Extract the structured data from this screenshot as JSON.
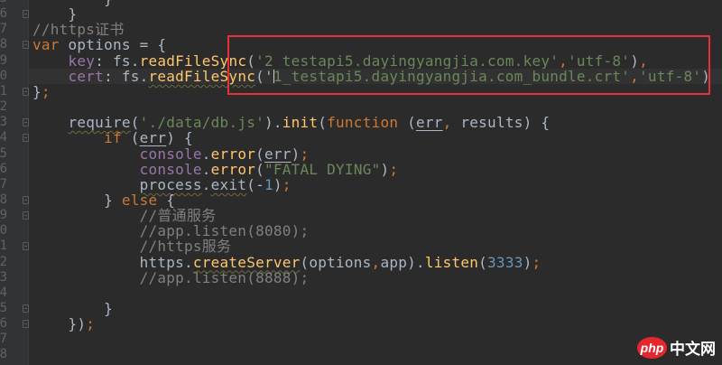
{
  "editor": {
    "current_line_index": 5,
    "lines": [
      {
        "num": "5",
        "fold": false,
        "tokens": [
          [
            "        }",
            "pl"
          ]
        ]
      },
      {
        "num": "6",
        "fold": true,
        "tokens": [
          [
            "    }",
            "pl"
          ]
        ]
      },
      {
        "num": "7",
        "fold": false,
        "tokens": [
          [
            "//https证书",
            "cm"
          ]
        ]
      },
      {
        "num": "8",
        "fold": true,
        "tokens": [
          [
            "var",
            "kw"
          ],
          [
            " options = {",
            "pl"
          ]
        ]
      },
      {
        "num": "9",
        "fold": false,
        "tokens": [
          [
            "    ",
            "pl"
          ],
          [
            "key",
            "prop"
          ],
          [
            ": fs.",
            "pl"
          ],
          [
            "readFileSync",
            "fn wavy"
          ],
          [
            "(",
            "pl"
          ],
          [
            "'2_testapi5.dayingyangjia.com.key'",
            "str"
          ],
          [
            ",",
            "pu"
          ],
          [
            "'utf-8'",
            "str"
          ],
          [
            ")",
            "pl"
          ],
          [
            ",",
            "pu"
          ]
        ]
      },
      {
        "num": "0",
        "fold": false,
        "tokens": [
          [
            "    ",
            "pl"
          ],
          [
            "cert",
            "prop"
          ],
          [
            ": fs.",
            "pl"
          ],
          [
            "readFileSync",
            "fn wavy"
          ],
          [
            "('",
            "pl"
          ],
          [
            "|",
            "caret"
          ],
          [
            "1_testapi5.dayingyangjia.com_bundle.crt'",
            "str"
          ],
          [
            ",",
            "pu"
          ],
          [
            "'utf-8'",
            "str"
          ],
          [
            ")",
            "pl"
          ]
        ]
      },
      {
        "num": "1",
        "fold": true,
        "tokens": [
          [
            "}",
            "pl"
          ],
          [
            ";",
            "pu"
          ]
        ]
      },
      {
        "num": "2",
        "fold": false,
        "tokens": []
      },
      {
        "num": "3",
        "fold": true,
        "tokens": [
          [
            "    ",
            "pl"
          ],
          [
            "require",
            "pl wavy"
          ],
          [
            "(",
            "pl"
          ],
          [
            "'./data/db.js'",
            "str"
          ],
          [
            ").",
            "pl"
          ],
          [
            "init",
            "fn"
          ],
          [
            "(",
            "pl"
          ],
          [
            "function",
            "kw"
          ],
          [
            " (",
            "pl"
          ],
          [
            "err",
            "pl ul"
          ],
          [
            ", ",
            "pu"
          ],
          [
            "results",
            "pl"
          ],
          [
            ") {",
            "pl"
          ]
        ]
      },
      {
        "num": "4",
        "fold": true,
        "tokens": [
          [
            "        ",
            "pl"
          ],
          [
            "if",
            "kw"
          ],
          [
            " (",
            "pl"
          ],
          [
            "err",
            "pl ul"
          ],
          [
            ") {",
            "pl"
          ]
        ]
      },
      {
        "num": "5",
        "fold": false,
        "tokens": [
          [
            "            ",
            "pl"
          ],
          [
            "console",
            "prop"
          ],
          [
            ".",
            "pl"
          ],
          [
            "error",
            "fn"
          ],
          [
            "(",
            "pl"
          ],
          [
            "err",
            "pl ul"
          ],
          [
            ")",
            "pl"
          ],
          [
            ";",
            "pu"
          ]
        ]
      },
      {
        "num": "6",
        "fold": false,
        "tokens": [
          [
            "            ",
            "pl"
          ],
          [
            "console",
            "prop"
          ],
          [
            ".",
            "pl"
          ],
          [
            "error",
            "fn"
          ],
          [
            "(",
            "pl"
          ],
          [
            "\"FATAL DYING\"",
            "str"
          ],
          [
            ")",
            "pl"
          ],
          [
            ";",
            "pu"
          ]
        ]
      },
      {
        "num": "7",
        "fold": false,
        "tokens": [
          [
            "            ",
            "pl"
          ],
          [
            "process",
            "pl wavy"
          ],
          [
            ".",
            "pl"
          ],
          [
            "exit",
            "pl wavy"
          ],
          [
            "(-",
            "pl"
          ],
          [
            "1",
            "num"
          ],
          [
            ")",
            "pl"
          ],
          [
            ";",
            "pu"
          ]
        ]
      },
      {
        "num": "8",
        "fold": true,
        "tokens": [
          [
            "        } ",
            "pl"
          ],
          [
            "else",
            "kw"
          ],
          [
            " {",
            "pl"
          ]
        ]
      },
      {
        "num": "9",
        "fold": true,
        "tokens": [
          [
            "            ",
            "pl"
          ],
          [
            "//普通服务",
            "cm"
          ]
        ]
      },
      {
        "num": "0",
        "fold": false,
        "tokens": [
          [
            "            ",
            "pl"
          ],
          [
            "//app.listen(8080);",
            "cm"
          ]
        ]
      },
      {
        "num": "1",
        "fold": true,
        "tokens": [
          [
            "            ",
            "pl"
          ],
          [
            "//https服务",
            "cm"
          ]
        ]
      },
      {
        "num": "2",
        "fold": false,
        "tokens": [
          [
            "            https.",
            "pl"
          ],
          [
            "createServer",
            "fn wavy"
          ],
          [
            "(options",
            "pl"
          ],
          [
            ",",
            "pu"
          ],
          [
            "app).",
            "pl"
          ],
          [
            "listen",
            "fn"
          ],
          [
            "(",
            "pl"
          ],
          [
            "3333",
            "num"
          ],
          [
            ")",
            "pl"
          ],
          [
            ";",
            "pu"
          ]
        ]
      },
      {
        "num": "3",
        "fold": false,
        "tokens": [
          [
            "            ",
            "pl"
          ],
          [
            "//app.listen(8888);",
            "cm"
          ]
        ]
      },
      {
        "num": "4",
        "fold": false,
        "tokens": []
      },
      {
        "num": "5",
        "fold": true,
        "tokens": [
          [
            "        }",
            "pl"
          ]
        ]
      },
      {
        "num": "6",
        "fold": true,
        "tokens": [
          [
            "    })",
            "pl"
          ],
          [
            ";",
            "pu"
          ]
        ]
      },
      {
        "num": "7",
        "fold": false,
        "tokens": []
      },
      {
        "num": "8",
        "fold": false,
        "tokens": []
      }
    ]
  },
  "watermark": {
    "logo": "php",
    "text": "中文网"
  },
  "colors": {
    "background": "#2b2b2b",
    "keyword": "#cc7832",
    "string": "#6a8759",
    "function": "#ffc66d",
    "number": "#6897bb",
    "comment": "#808080",
    "highlight_box": "#e8303a"
  }
}
